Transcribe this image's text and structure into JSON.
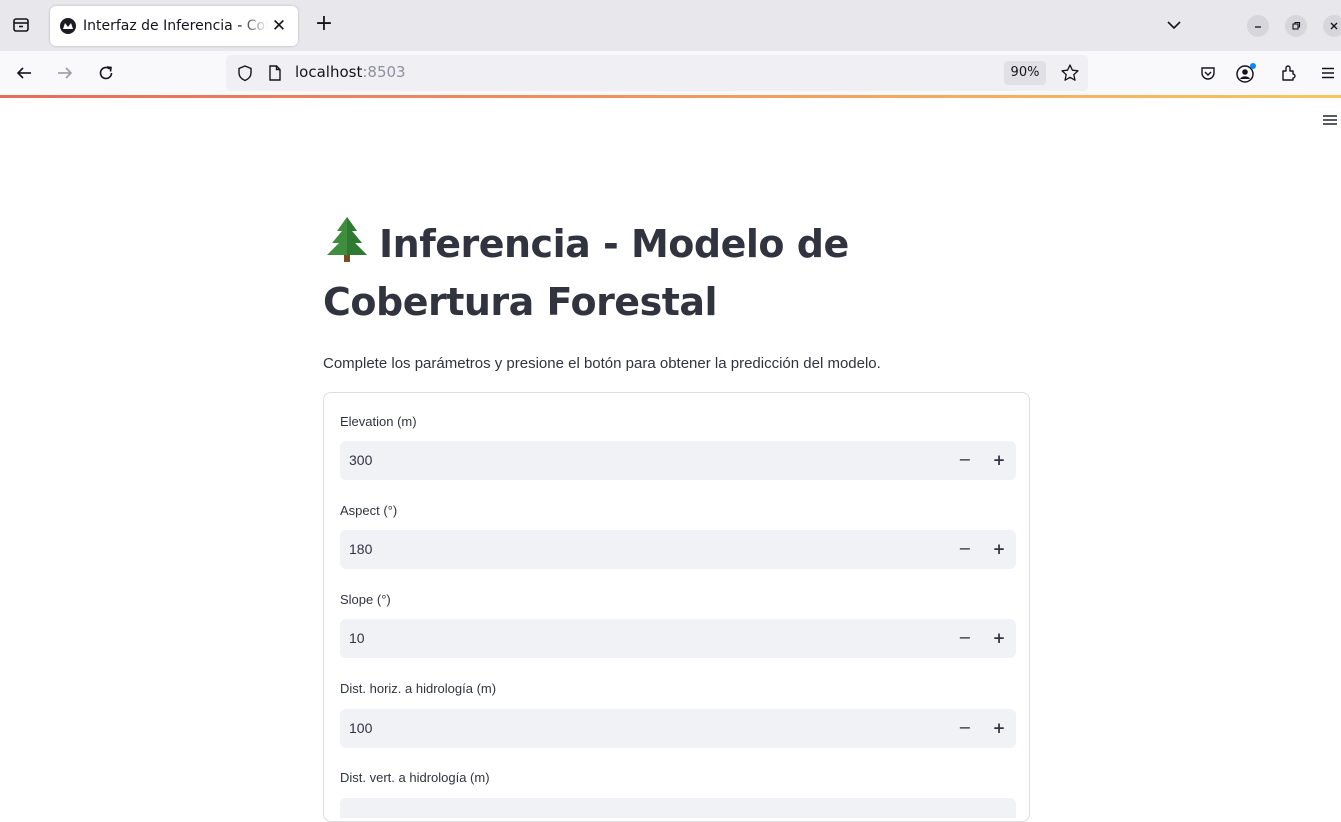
{
  "browser": {
    "tab_title": "Interfaz de Inferencia - Cobertura Forestal",
    "url_host": "localhost",
    "url_port": ":8503",
    "zoom": "90%"
  },
  "page": {
    "title_emoji": "🌲",
    "title": "Inferencia - Modelo de Cobertura Forestal",
    "subtitle": "Complete los parámetros y presione el botón para obtener la predicción del modelo."
  },
  "form": {
    "fields": [
      {
        "label": "Elevation (m)",
        "value": "300"
      },
      {
        "label": "Aspect (°)",
        "value": "180"
      },
      {
        "label": "Slope (°)",
        "value": "10"
      },
      {
        "label": "Dist. horiz. a hidrología (m)",
        "value": "100"
      },
      {
        "label": "Dist. vert. a hidrología (m)",
        "value": ""
      }
    ],
    "minus_symbol": "−",
    "plus_symbol": "+"
  }
}
